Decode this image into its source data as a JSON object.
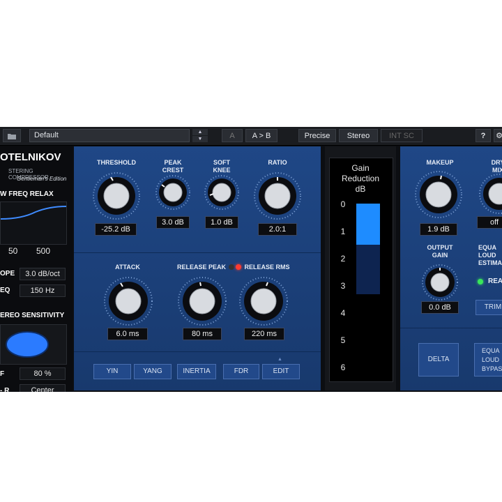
{
  "topbar": {
    "preset": "Default",
    "ab_a": "A",
    "ab_copy": "A > B",
    "precise": "Precise",
    "stereo": "Stereo",
    "int_sc": "INT SC",
    "help": "?"
  },
  "left": {
    "title": "OTELNIKOV",
    "subtitle": "STERING COMPRESSOR",
    "edition": "Gentleman's Edition",
    "low_freq_relax": "W FREQ RELAX",
    "eq_ticks": [
      "50",
      "500"
    ],
    "slope_label": "OPE",
    "slope_value": "3.0 dB/oct",
    "freq_label": "EQ",
    "freq_value": "150 Hz",
    "stereo_sensitivity": "EREO SENSITIVITY",
    "f_label": "F",
    "f_value": "80 %",
    "lr_label": "- R",
    "lr_value": "Center"
  },
  "main": {
    "threshold": {
      "label": "THRESHOLD",
      "value": "-25.2 dB"
    },
    "peak_crest": {
      "label1": "PEAK",
      "label2": "CREST",
      "value": "3.0 dB"
    },
    "soft_knee": {
      "label1": "SOFT",
      "label2": "KNEE",
      "value": "1.0 dB"
    },
    "ratio": {
      "label": "RATIO",
      "value": "2.0:1"
    },
    "attack": {
      "label": "ATTACK",
      "value": "6.0 ms"
    },
    "release_peak": {
      "label": "RELEASE PEAK",
      "value": "80 ms"
    },
    "release_rms": {
      "label": "RELEASE RMS",
      "value": "220 ms"
    },
    "modes": [
      "YIN",
      "YANG",
      "INERTIA",
      "FDR",
      "EDIT"
    ]
  },
  "meter": {
    "title1": "Gain",
    "title2": "Reduction",
    "title3": "dB",
    "scale": [
      "0",
      "1",
      "2",
      "3",
      "4",
      "5",
      "6"
    ],
    "gain_reduction_db": 1.5,
    "color_active": "#1e8cff"
  },
  "right": {
    "makeup": {
      "label": "MAKEUP",
      "value": "1.9 dB"
    },
    "dry_mix": {
      "label1": "DRY",
      "label2": "MIX",
      "value": "off"
    },
    "output_gain": {
      "label1": "OUTPUT",
      "label2": "GAIN",
      "value": "0.0 dB"
    },
    "equal_loud": {
      "label1": "EQUA",
      "label2": "LOUD",
      "label3": "ESTIMA"
    },
    "real_label": "REAL",
    "trim": "TRIM",
    "delta": "DELTA",
    "bypass1": "EQUA",
    "bypass2": "LOUD",
    "bypass3": "BYPAS"
  },
  "colors": {
    "panel_blue": "#1f4786",
    "led_green": "#39e65a",
    "led_red": "#ff3b30",
    "stereo_ellipse": "#2b7bff"
  }
}
